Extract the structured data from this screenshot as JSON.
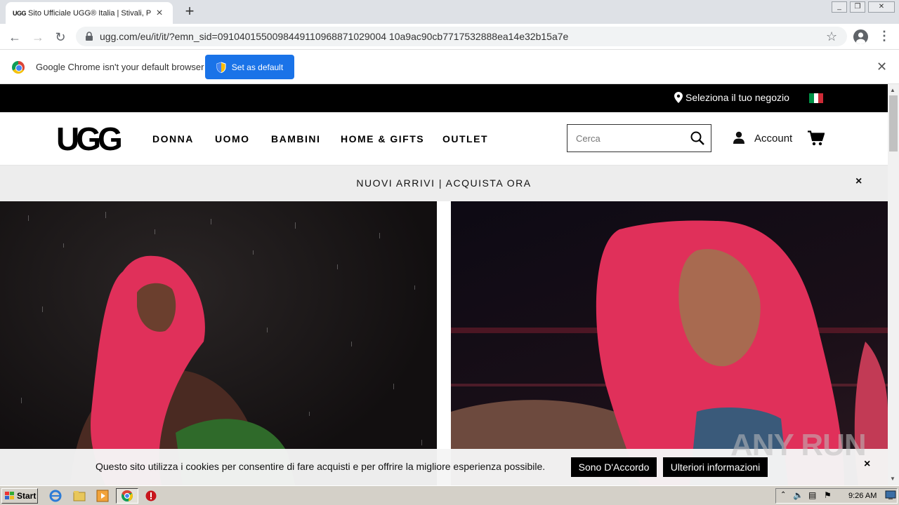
{
  "browser": {
    "tab_title": "Sito Ufficiale UGG® Italia | Stivali, P",
    "tab_favicon": "UGG",
    "url": "ugg.com/eu/it/it/?emn_sid=0910401550098449110968871029004 10a9ac90cb7717532888ea14e32b15a7e",
    "infobar_text": "Google Chrome isn't your default browser",
    "set_default_label": "Set as default"
  },
  "site": {
    "store_link": "Seleziona il tuo negozio",
    "logo": "UGG",
    "nav": [
      "DONNA",
      "UOMO",
      "BAMBINI",
      "HOME & GIFTS",
      "OUTLET"
    ],
    "search_placeholder": "Cerca",
    "account_label": "Account",
    "promo_text": "NUOVI ARRIVI | ACQUISTA ORA",
    "promo_close": "×"
  },
  "cookie": {
    "text": "Questo sito utilizza i cookies per consentire di fare acquisti e per offrire la migliore esperienza possibile.",
    "accept_label": "Sono D'Accordo",
    "more_label": "Ulteriori informazioni",
    "close": "×"
  },
  "watermark": "ANY RUN",
  "taskbar": {
    "start_label": "Start",
    "clock": "9:26 AM"
  },
  "colors": {
    "chrome_blue": "#1a73e8",
    "hair_pink": "#e0305a",
    "flag_green": "#009246",
    "flag_white": "#ffffff",
    "flag_red": "#ce2b37"
  }
}
